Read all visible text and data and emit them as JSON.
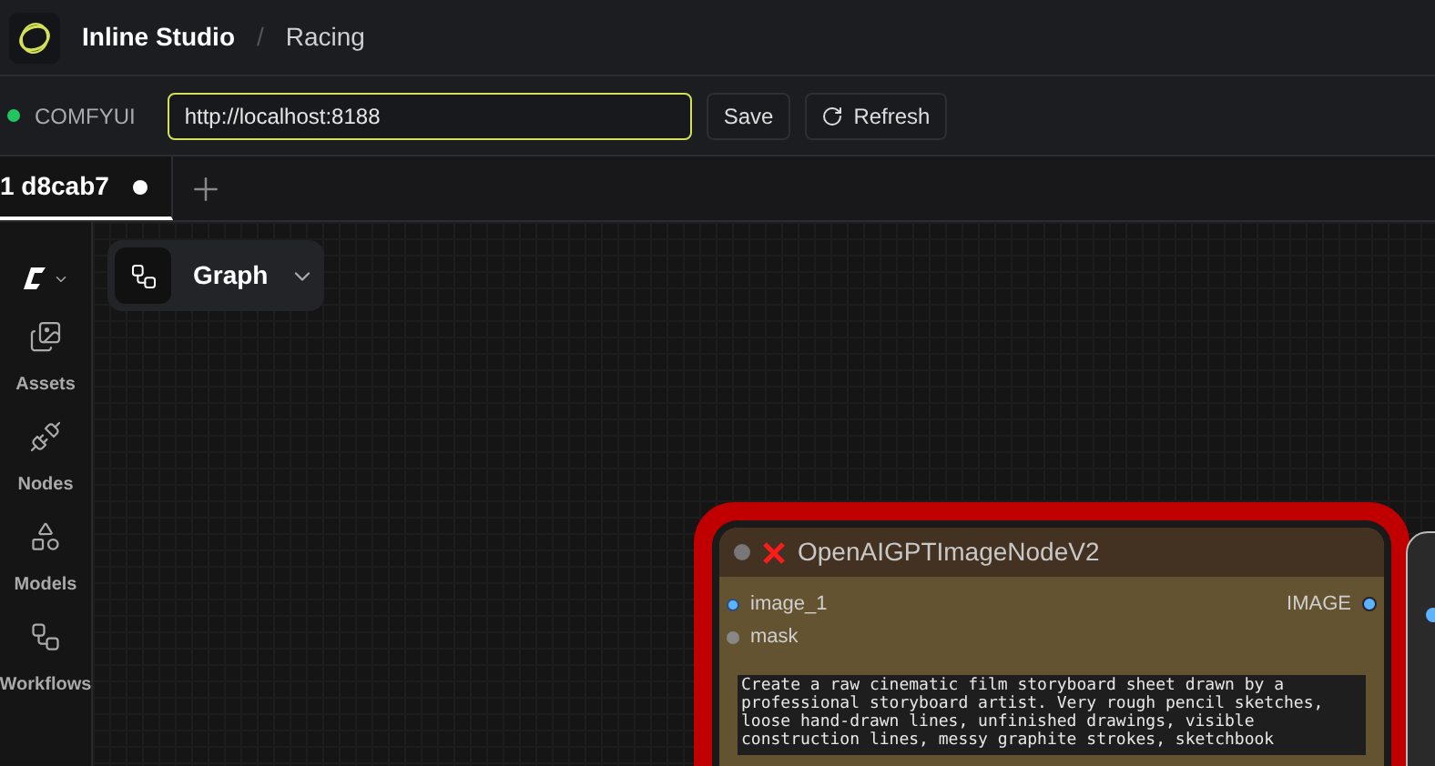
{
  "header": {
    "app_name": "Inline Studio",
    "separator": "/",
    "project": "Racing"
  },
  "connection": {
    "label": "COMFYUI",
    "connected": true,
    "url": "http://localhost:8188",
    "buttons": [
      "Save",
      "Refresh"
    ]
  },
  "tabs": [
    {
      "label": "1 d8cab7",
      "selected": true,
      "unsaved": true
    }
  ],
  "sidebar": {
    "items": [
      {
        "label": "Assets",
        "kind": "assets"
      },
      {
        "label": "Nodes",
        "kind": "nodes"
      },
      {
        "label": "Models",
        "kind": "models"
      },
      {
        "label": "Workflows",
        "kind": "workflows"
      }
    ]
  },
  "view_menu": {
    "label": "Graph"
  },
  "node": {
    "title": "OpenAIGPTImageNodeV2",
    "error": true,
    "inputs": [
      {
        "name": "image_1",
        "connected": true
      },
      {
        "name": "mask",
        "connected": false
      }
    ],
    "output": "IMAGE",
    "prompt": "Create a raw cinematic film storyboard sheet drawn by a professional storyboard artist. Very rough pencil sketches, loose hand-drawn lines, unfinished drawings, visible construction lines, messy graphite strokes, sketchbook"
  }
}
